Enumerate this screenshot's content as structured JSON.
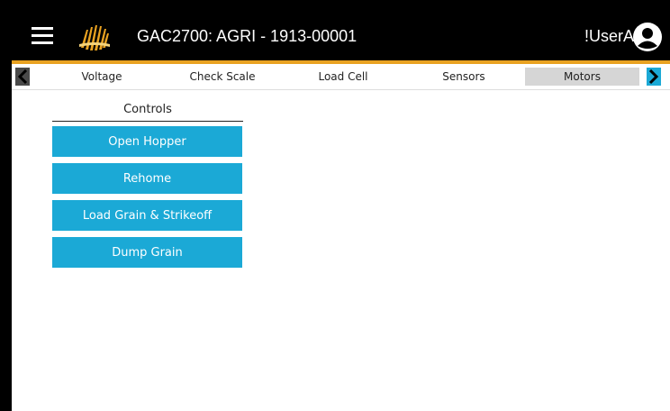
{
  "header": {
    "title": "GAC2700: AGRI - 1913-00001",
    "username": "!UserA"
  },
  "tabs": [
    {
      "label": "Voltage"
    },
    {
      "label": "Check Scale"
    },
    {
      "label": "Load Cell"
    },
    {
      "label": "Sensors"
    },
    {
      "label": "Motors",
      "active": true
    }
  ],
  "controls": {
    "title": "Controls",
    "buttons": [
      {
        "label": "Open Hopper"
      },
      {
        "label": "Rehome"
      },
      {
        "label": "Load Grain & Strikeoff"
      },
      {
        "label": "Dump Grain"
      }
    ]
  },
  "colors": {
    "accent": "#1ba9d6",
    "gold": "#e9a221",
    "active_tab": "#d6d6d6"
  },
  "icons": {
    "menu": "hamburger-icon",
    "logo": "grain-logo",
    "account": "account-circle-icon",
    "prev": "chevron-left-icon",
    "next": "chevron-right-icon"
  }
}
